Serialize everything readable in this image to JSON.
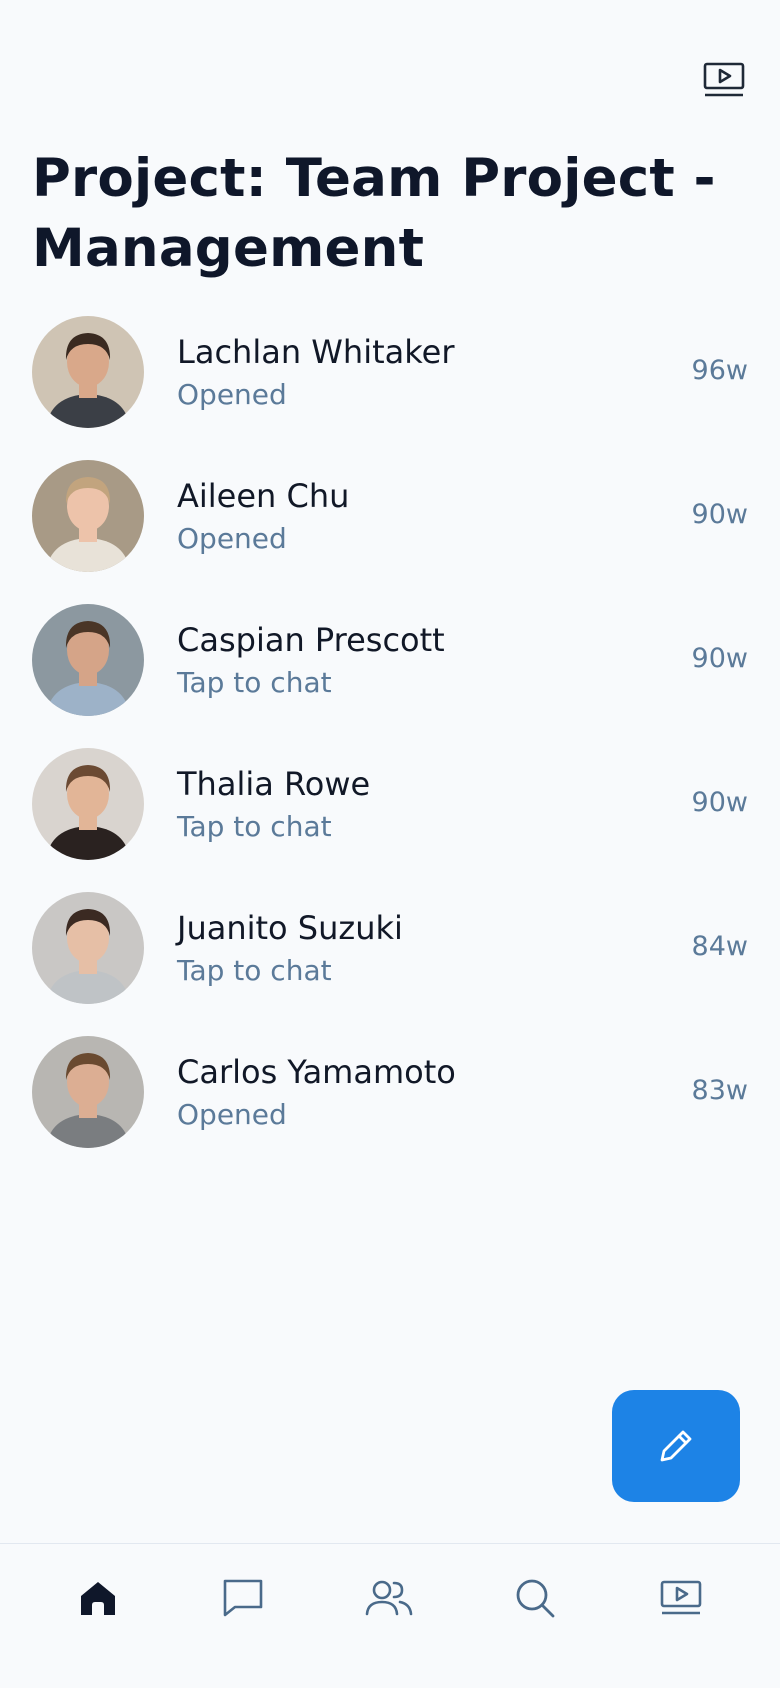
{
  "header": {
    "video_icon": "video-icon",
    "title": "Project: Team Project - Management"
  },
  "chats": [
    {
      "name": "Lachlan Whitaker",
      "status": "Opened",
      "time": "96w",
      "avatar": {
        "bg": "#cfc4b4",
        "skin": "#d9a88a",
        "hair": "#3a2a20",
        "shirt": "#3b3f46"
      }
    },
    {
      "name": "Aileen Chu",
      "status": "Opened",
      "time": "90w",
      "avatar": {
        "bg": "#a89a86",
        "skin": "#edc3aa",
        "hair": "#c2a47e",
        "shirt": "#e8e2d8"
      }
    },
    {
      "name": "Caspian Prescott",
      "status": "Tap to chat",
      "time": "90w",
      "avatar": {
        "bg": "#8c98a0",
        "skin": "#d5a488",
        "hair": "#4a3526",
        "shirt": "#9db2c8"
      }
    },
    {
      "name": "Thalia Rowe",
      "status": "Tap to chat",
      "time": "90w",
      "avatar": {
        "bg": "#d9d4cf",
        "skin": "#e2b597",
        "hair": "#6b4a33",
        "shirt": "#2a2220"
      }
    },
    {
      "name": "Juanito Suzuki",
      "status": "Tap to chat",
      "time": "84w",
      "avatar": {
        "bg": "#c9c7c5",
        "skin": "#e6bfa6",
        "hair": "#3b2a22",
        "shirt": "#bfc3c6"
      }
    },
    {
      "name": "Carlos Yamamoto",
      "status": "Opened",
      "time": "83w",
      "avatar": {
        "bg": "#b8b6b2",
        "skin": "#dcae93",
        "hair": "#6a4a30",
        "shirt": "#7a7d80"
      }
    }
  ],
  "fab": {
    "icon": "pencil-icon",
    "color": "#1d83e6"
  },
  "bottom_nav": [
    {
      "icon": "home-icon",
      "active": true
    },
    {
      "icon": "message-icon",
      "active": false
    },
    {
      "icon": "people-icon",
      "active": false
    },
    {
      "icon": "search-icon",
      "active": false
    },
    {
      "icon": "video-icon",
      "active": false
    }
  ],
  "colors": {
    "background": "#f8fafc",
    "title": "#0f172a",
    "secondary_text": "#5b7a99",
    "nav_icon": "#4a6a8a",
    "nav_active": "#0f172a",
    "accent": "#1d83e6"
  }
}
